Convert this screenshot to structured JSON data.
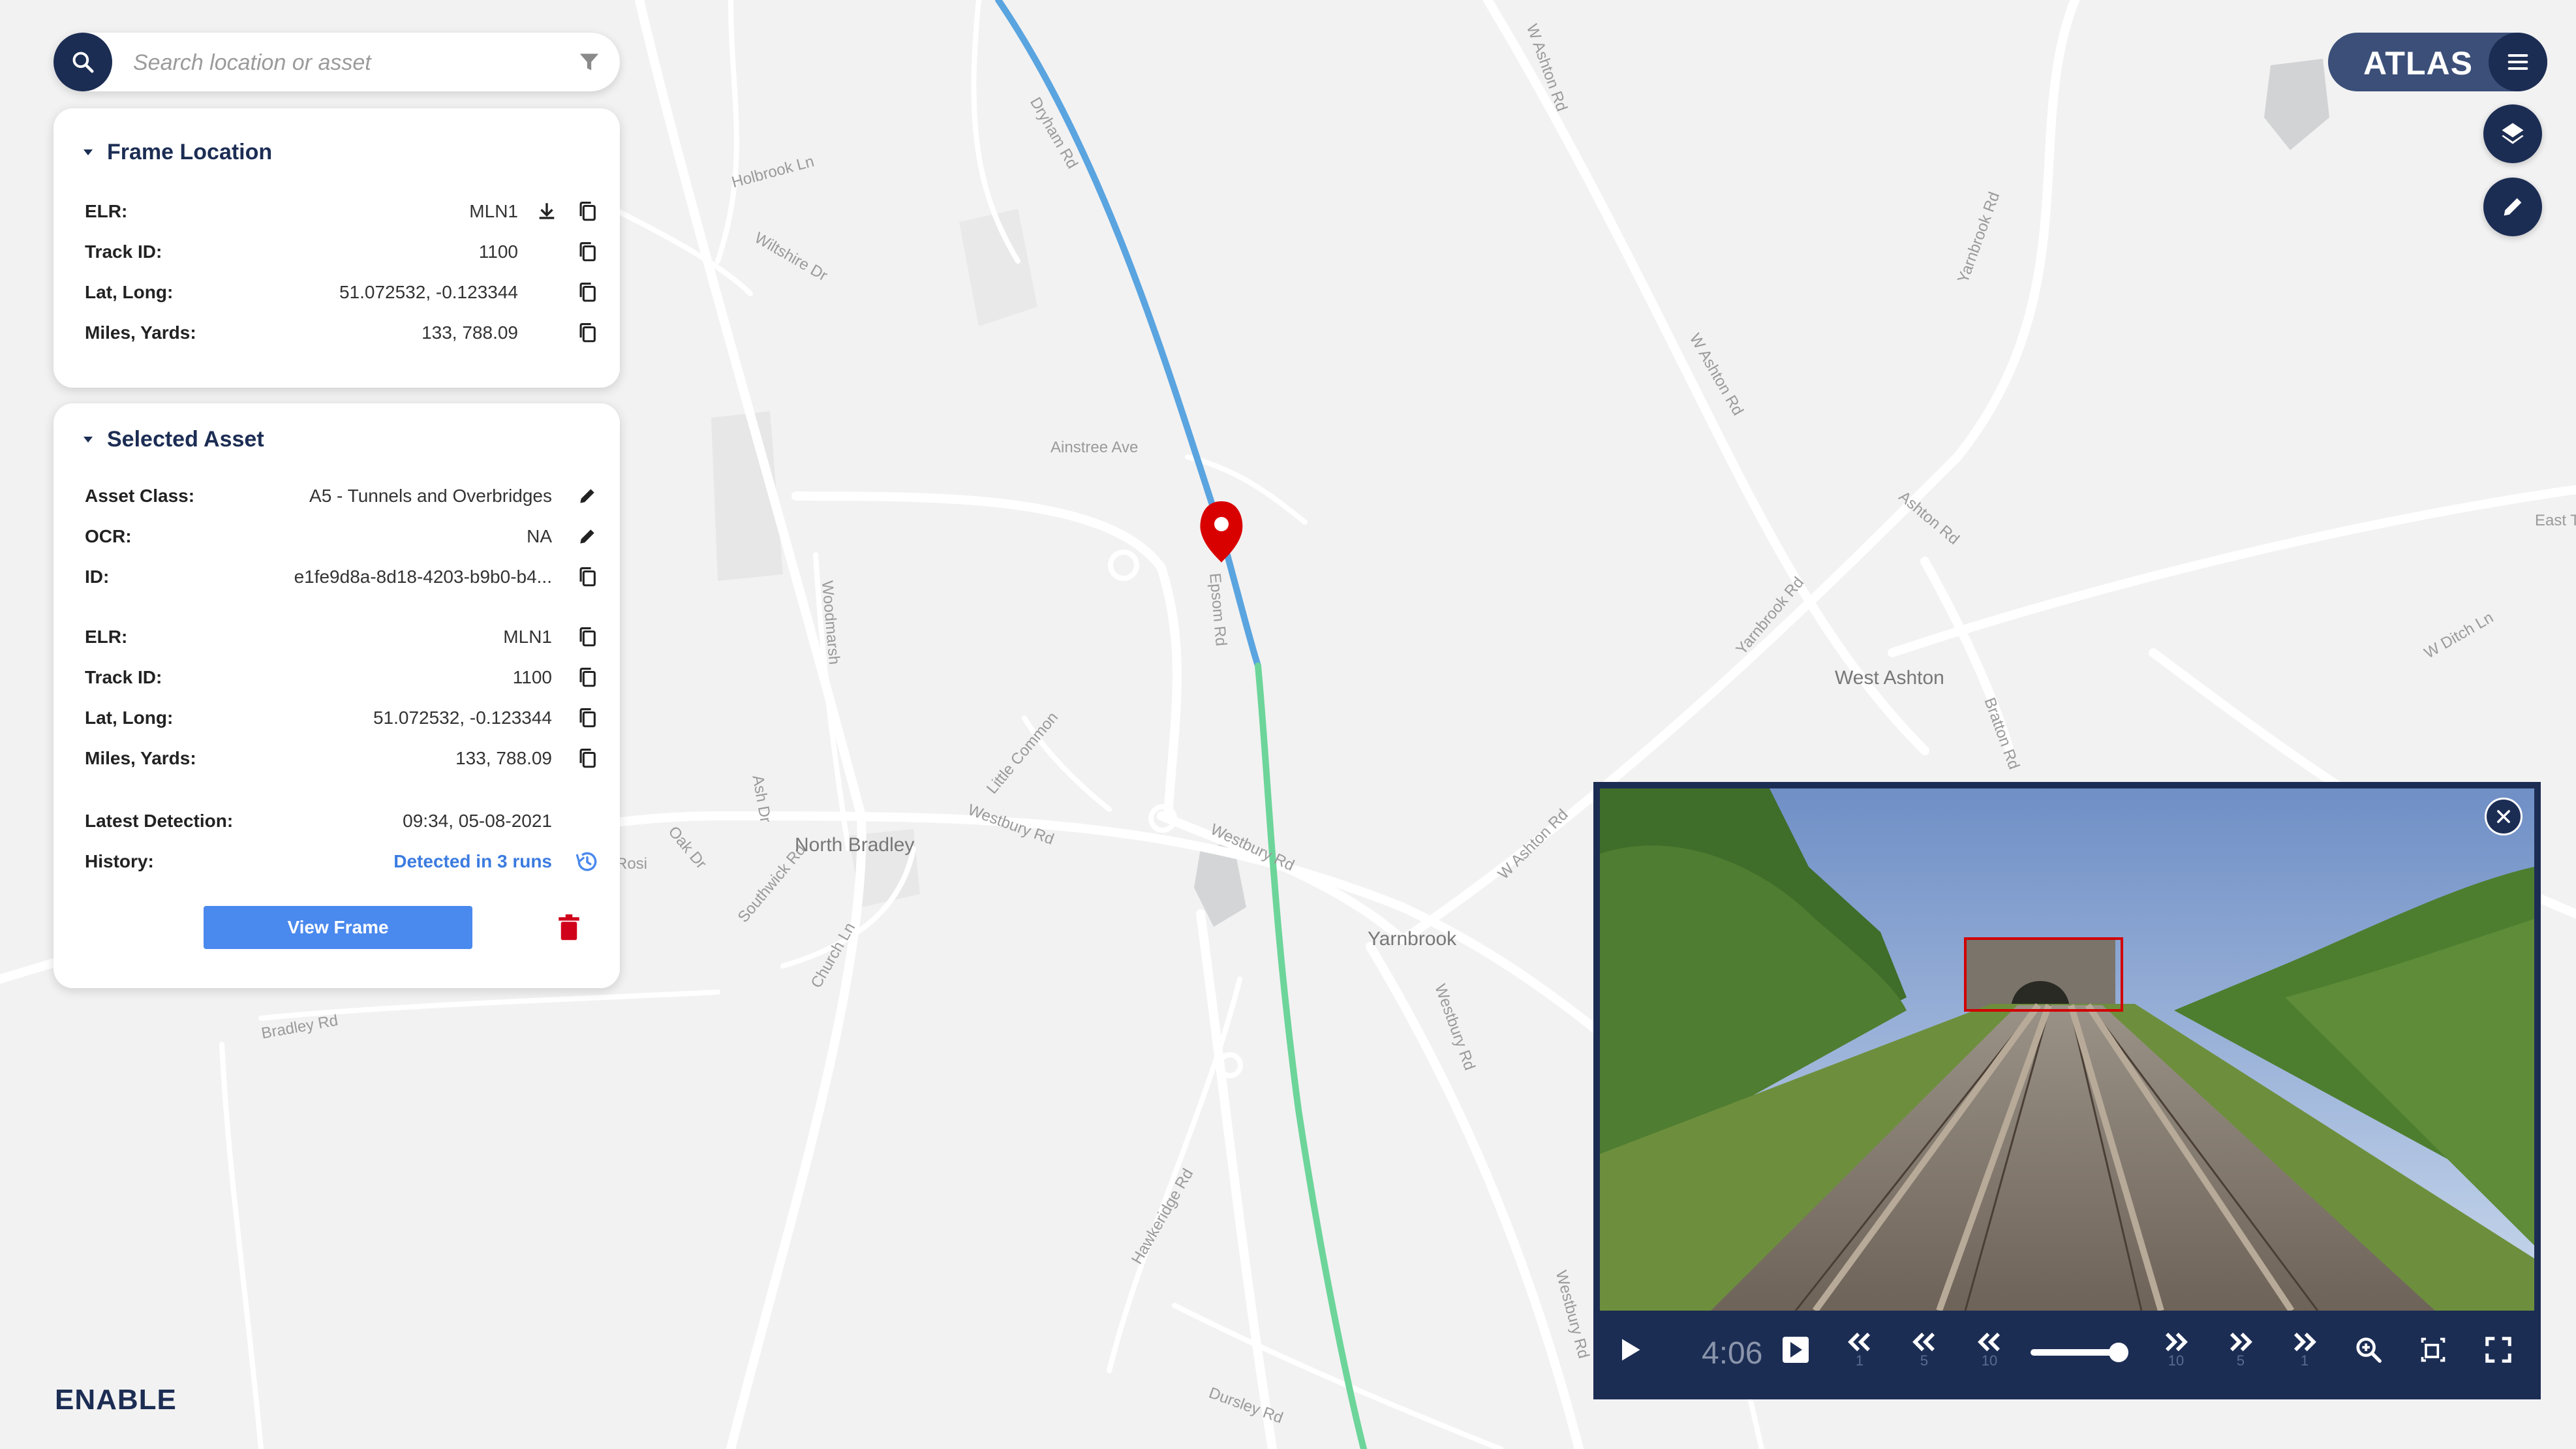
{
  "search": {
    "placeholder": "Search location or asset"
  },
  "map": {
    "streets": [
      "Dryham Rd",
      "Holbrook Ln",
      "Wiltshire Dr",
      "Ainstree Ave",
      "Woodmarsh",
      "Epsom Rd",
      "Little Common",
      "Westbury Rd",
      "Westbury Rd",
      "Southwick Rd",
      "Oak Dr",
      "Church Ln",
      "Bradley Rd",
      "Hawkeridge Rd",
      "Dursley Rd",
      "Westbury Rd",
      "Westbury Rd",
      "W Ashton Rd",
      "W Ashton Rd",
      "Yarnbrook Rd",
      "Yarnbrook Rd",
      "W Ashton Rd",
      "Bratton Rd",
      "W Ditch Ln",
      "Ashton Rd",
      "Ash Dr",
      "East T",
      "Rosi"
    ],
    "places": [
      "North Bradley",
      "Yarnbrook",
      "West Ashton"
    ],
    "route_colors": {
      "past": "#5aa4e0",
      "ahead": "#6dd59a"
    },
    "pin_color": "#d90000"
  },
  "frame_location": {
    "title": "Frame Location",
    "rows": [
      {
        "label": "ELR:",
        "value": "MLN1"
      },
      {
        "label": "Track ID:",
        "value": "1100"
      },
      {
        "label": "Lat, Long:",
        "value": "51.072532, -0.123344"
      },
      {
        "label": "Miles, Yards:",
        "value": "133, 788.09"
      }
    ]
  },
  "selected_asset": {
    "title": "Selected Asset",
    "rows": [
      {
        "label": "Asset Class:",
        "value": "A5 - Tunnels and Overbridges"
      },
      {
        "label": "OCR:",
        "value": "NA"
      },
      {
        "label": "ID:",
        "value": "e1fe9d8a-8d18-4203-b9b0-b4..."
      },
      {
        "label": "ELR:",
        "value": "MLN1"
      },
      {
        "label": "Track ID:",
        "value": "1100"
      },
      {
        "label": "Lat, Long:",
        "value": "51.072532, -0.123344"
      },
      {
        "label": "Miles, Yards:",
        "value": "133, 788.09"
      },
      {
        "label": "Latest Detection:",
        "value": "09:34, 05-08-2021"
      },
      {
        "label": "History:",
        "value": "Detected in 3 runs"
      }
    ],
    "view_frame_label": "View Frame"
  },
  "brand": {
    "app_name": "ATLAS",
    "footer_logo": "ENABLE"
  },
  "player": {
    "time": "4:06",
    "step_labels": [
      "1",
      "5",
      "10",
      "10",
      "5",
      "1"
    ],
    "volume": 0.85,
    "detection_color": "#d10000"
  },
  "colors": {
    "navy": "#1c2d54",
    "accent_blue": "#4a89ee",
    "delete_red": "#d0021b"
  }
}
